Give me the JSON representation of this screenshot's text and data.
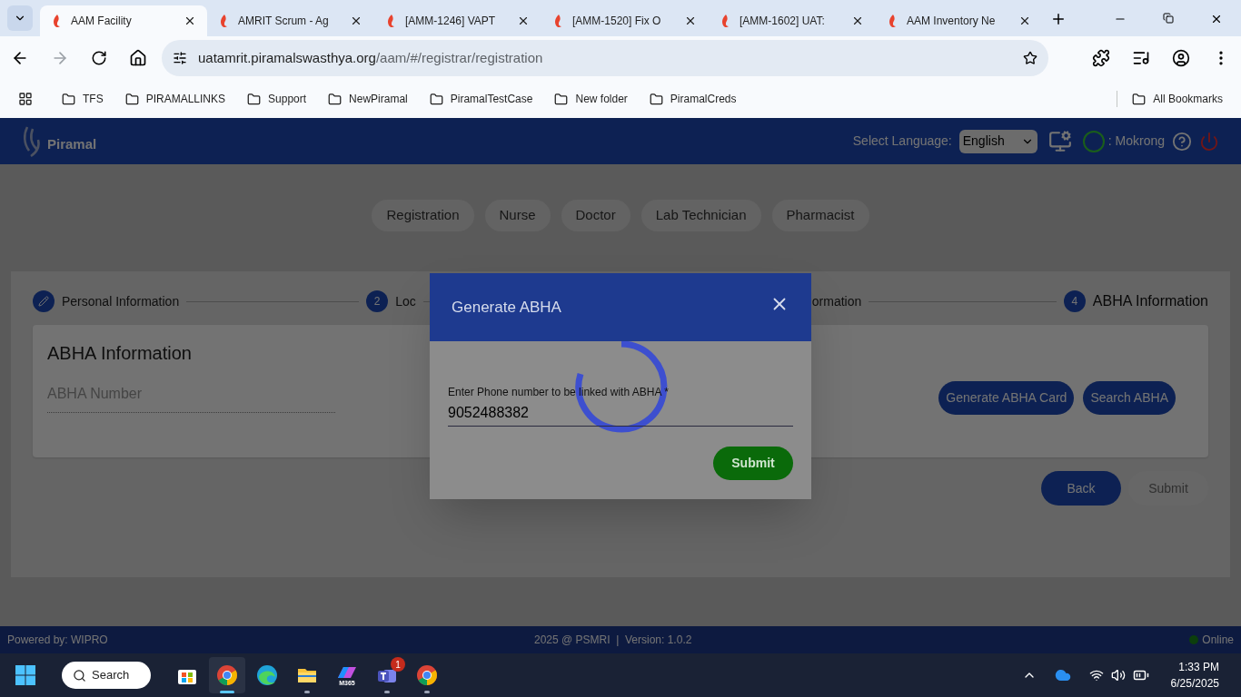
{
  "browser": {
    "tabs": [
      {
        "title": "AAM Facility",
        "selected": true
      },
      {
        "title": "AMRIT Scrum - Ag",
        "selected": false
      },
      {
        "title": "[AMM-1246] VAPT",
        "selected": false
      },
      {
        "title": "[AMM-1520] Fix O",
        "selected": false
      },
      {
        "title": "[AMM-1602] UAT:",
        "selected": false
      },
      {
        "title": "AAM Inventory Ne",
        "selected": false
      }
    ],
    "address": {
      "host": "uatamrit.piramalswasthya.org",
      "path": "/aam/#/registrar/registration"
    },
    "bookmarks": [
      "TFS",
      "PIRAMALLINKS",
      "Support",
      "NewPiramal",
      "PiramalTestCase",
      "New folder",
      "PiramalCreds"
    ],
    "all_bookmarks": "All Bookmarks"
  },
  "header": {
    "brand": "Piramal",
    "language_label": "Select Language:",
    "language": "English",
    "user": ": Mokrong"
  },
  "roles": [
    {
      "label": "Registration"
    },
    {
      "label": "Nurse"
    },
    {
      "label": "Doctor"
    },
    {
      "label": "Lab Technician"
    },
    {
      "label": "Pharmacist"
    }
  ],
  "steps": [
    {
      "kind": "edit",
      "label": "Personal Information",
      "selected": false
    },
    {
      "kind": "number",
      "number": "2",
      "label": "Loc",
      "selected": false
    },
    {
      "kind": "hidden",
      "label": "ormation",
      "selected": false
    },
    {
      "kind": "number",
      "number": "4",
      "label": "ABHA Information",
      "selected": true
    }
  ],
  "abha": {
    "title": "ABHA Information",
    "placeholder": "ABHA Number",
    "buttons": [
      "Generate ABHA Card",
      "Search ABHA"
    ]
  },
  "actions": [
    {
      "label": "Back",
      "disabled": false
    },
    {
      "label": "Submit",
      "disabled": true
    }
  ],
  "footer": {
    "powered": "Powered by: WIPRO",
    "copyright": "2025 @ PSMRI  |  Version: 1.0.2",
    "status": "Online"
  },
  "modal": {
    "title": "Generate ABHA",
    "field_label": "Enter Phone number to be linked with ABHA *",
    "value": "9052488382",
    "submit": "Submit"
  },
  "taskbar": {
    "search": "Search",
    "apps": [
      {
        "kind": "store",
        "running": false
      },
      {
        "kind": "chrome",
        "running": true,
        "active": true
      },
      {
        "kind": "edge",
        "running": false
      },
      {
        "kind": "folder",
        "running": true
      },
      {
        "kind": "m365",
        "label": "M365",
        "running": false
      },
      {
        "kind": "teams",
        "badge": "1",
        "running": true
      },
      {
        "kind": "chrome",
        "running": true
      }
    ],
    "time": "1:33 PM",
    "date": "6/25/2025"
  }
}
